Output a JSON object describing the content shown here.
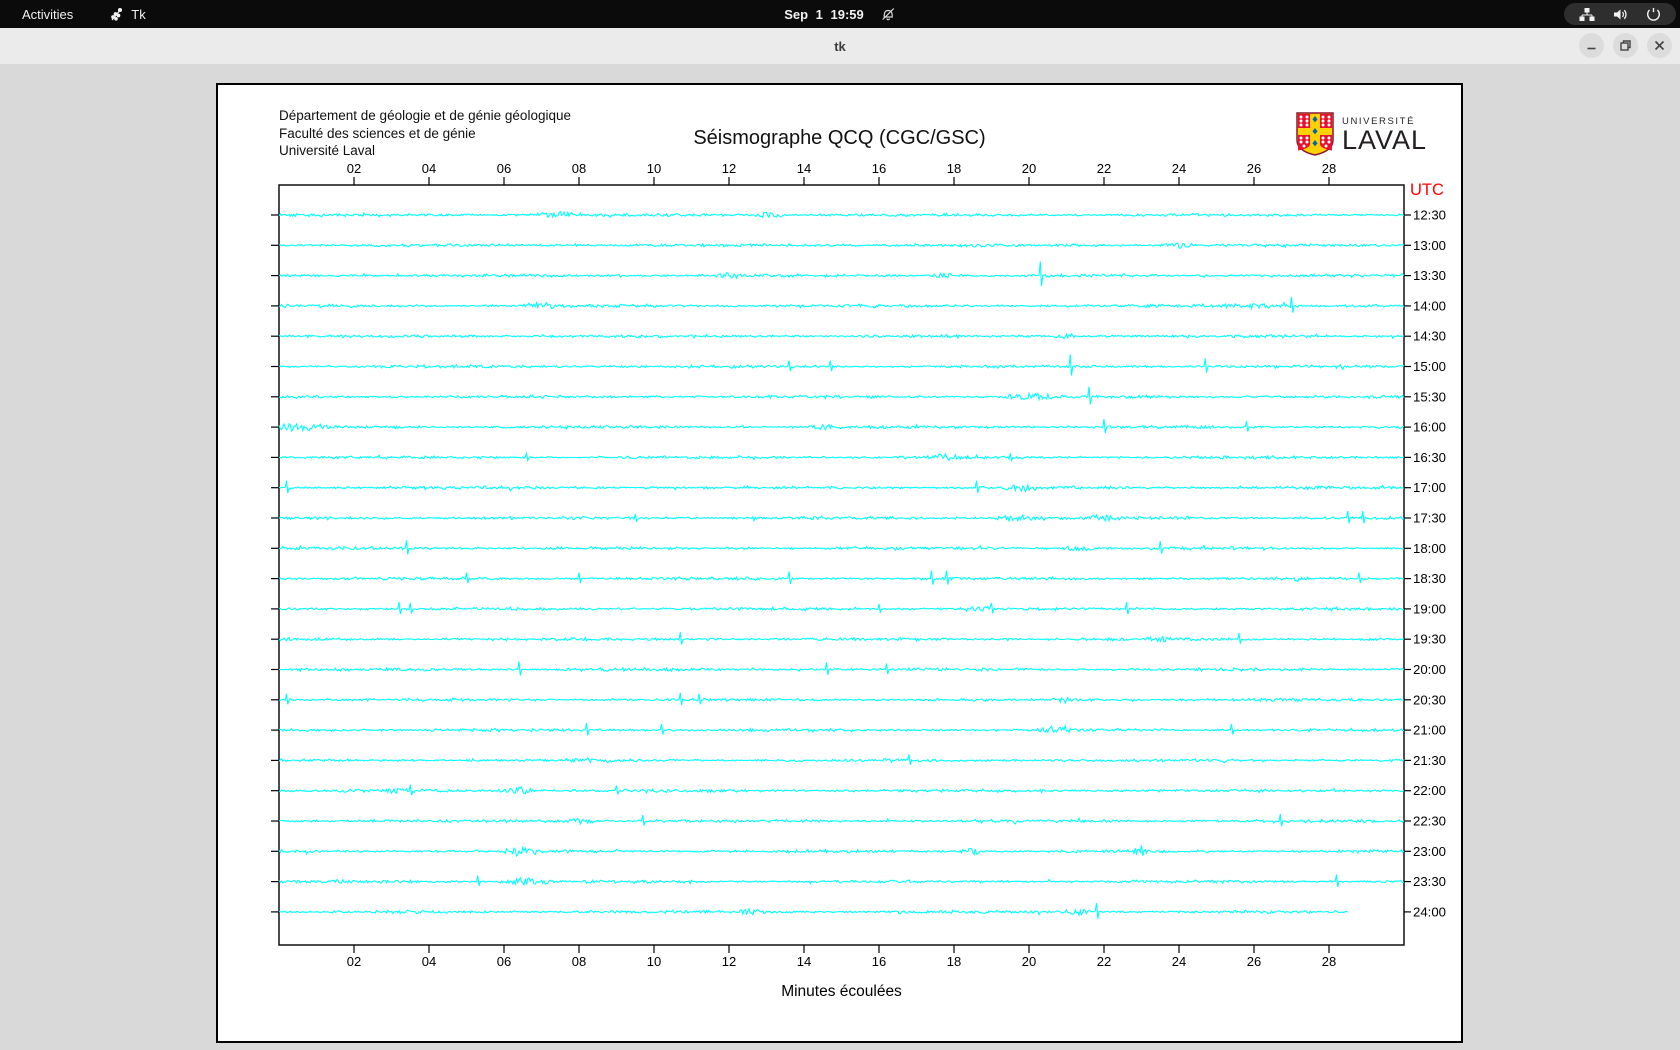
{
  "topbar": {
    "activities_label": "Activities",
    "app_label": "Tk",
    "clock": "Sep 1 19:59"
  },
  "titlebar": {
    "title": "tk"
  },
  "panel": {
    "header_lines": [
      "Département de géologie et de génie géologique",
      "Faculté des sciences et de génie",
      "Université Laval"
    ],
    "logo": {
      "line1": "UNIVERSITÉ",
      "line2": "LAVAL"
    }
  },
  "colors": {
    "trace": "#00ffff",
    "utc_label": "#ff0000",
    "panel_bg": "#ffffff",
    "window_bg": "#d9d9d9",
    "topbar_bg": "#0b0b0b",
    "frame": "#000000"
  },
  "chart_data": {
    "type": "line",
    "title": "Séismographe QCQ (CGC/GSC)",
    "xlabel": "Minutes écoulées",
    "right_axis_title": "UTC",
    "x_ticks": [
      "02",
      "04",
      "06",
      "08",
      "10",
      "12",
      "14",
      "16",
      "18",
      "20",
      "22",
      "24",
      "26",
      "28"
    ],
    "x_range_minutes": [
      0,
      30
    ],
    "grid": false,
    "legend": "none",
    "trace_color": "#00ffff",
    "traces": [
      {
        "utc": "12:30",
        "spikes": [],
        "bursts": [
          [
            7.4,
            0.8,
            3
          ],
          [
            13.0,
            0.5,
            3
          ]
        ]
      },
      {
        "utc": "13:00",
        "spikes": [],
        "bursts": [
          [
            24.0,
            0.5,
            3
          ]
        ]
      },
      {
        "utc": "13:30",
        "spikes": [
          [
            20.3,
            14
          ]
        ],
        "bursts": [
          [
            12.0,
            0.4,
            3
          ],
          [
            17.7,
            0.4,
            3
          ]
        ]
      },
      {
        "utc": "14:00",
        "spikes": [
          [
            27.0,
            9
          ]
        ],
        "bursts": [
          [
            7.1,
            0.6,
            3.5
          ],
          [
            26.0,
            1.5,
            2.5
          ]
        ]
      },
      {
        "utc": "14:30",
        "spikes": [],
        "bursts": [
          [
            21.0,
            0.3,
            3
          ]
        ]
      },
      {
        "utc": "15:00",
        "spikes": [
          [
            13.6,
            6
          ],
          [
            14.7,
            6
          ],
          [
            21.1,
            12
          ],
          [
            24.7,
            8
          ]
        ],
        "bursts": []
      },
      {
        "utc": "15:30",
        "spikes": [
          [
            21.6,
            10
          ]
        ],
        "bursts": [
          [
            19.9,
            0.8,
            3.5
          ]
        ]
      },
      {
        "utc": "16:00",
        "spikes": [
          [
            22.0,
            8
          ],
          [
            25.8,
            6
          ]
        ],
        "bursts": [
          [
            0.5,
            0.9,
            4
          ],
          [
            14.5,
            0.4,
            3
          ]
        ]
      },
      {
        "utc": "16:30",
        "spikes": [
          [
            6.6,
            4
          ],
          [
            19.5,
            4
          ]
        ],
        "bursts": [
          [
            17.8,
            0.5,
            3
          ]
        ]
      },
      {
        "utc": "17:00",
        "spikes": [
          [
            0.2,
            7
          ],
          [
            18.6,
            7
          ]
        ],
        "bursts": [
          [
            19.8,
            0.6,
            3.5
          ]
        ]
      },
      {
        "utc": "17:30",
        "spikes": [
          [
            9.5,
            4
          ],
          [
            28.5,
            7
          ],
          [
            28.9,
            7
          ]
        ],
        "bursts": [
          [
            19.7,
            0.7,
            3.5
          ],
          [
            22.0,
            0.5,
            3
          ]
        ]
      },
      {
        "utc": "18:00",
        "spikes": [
          [
            3.4,
            8
          ],
          [
            23.5,
            7
          ]
        ],
        "bursts": [
          [
            21.3,
            0.5,
            3
          ]
        ]
      },
      {
        "utc": "18:30",
        "spikes": [
          [
            5.0,
            6
          ],
          [
            8.0,
            6
          ],
          [
            13.6,
            7
          ],
          [
            17.4,
            8
          ],
          [
            17.8,
            8
          ],
          [
            28.8,
            6
          ]
        ],
        "bursts": []
      },
      {
        "utc": "19:00",
        "spikes": [
          [
            3.2,
            7
          ],
          [
            3.5,
            6
          ],
          [
            16.0,
            5
          ],
          [
            19.0,
            6
          ],
          [
            22.6,
            7
          ]
        ],
        "bursts": [
          [
            18.6,
            0.6,
            3
          ]
        ]
      },
      {
        "utc": "19:30",
        "spikes": [
          [
            10.7,
            7
          ],
          [
            25.6,
            6
          ]
        ],
        "bursts": [
          [
            23.5,
            0.4,
            3
          ]
        ]
      },
      {
        "utc": "20:00",
        "spikes": [
          [
            6.4,
            8
          ],
          [
            14.6,
            7
          ],
          [
            16.2,
            6
          ]
        ],
        "bursts": []
      },
      {
        "utc": "20:30",
        "spikes": [
          [
            0.2,
            6
          ],
          [
            10.7,
            7
          ],
          [
            11.2,
            6
          ]
        ],
        "bursts": [
          [
            20.9,
            0.5,
            3
          ]
        ]
      },
      {
        "utc": "21:00",
        "spikes": [
          [
            8.2,
            7
          ],
          [
            10.2,
            6
          ],
          [
            25.4,
            6
          ]
        ],
        "bursts": [
          [
            20.8,
            0.6,
            3.5
          ]
        ]
      },
      {
        "utc": "21:30",
        "spikes": [
          [
            16.8,
            6
          ]
        ],
        "bursts": [
          [
            8.0,
            0.4,
            3
          ]
        ]
      },
      {
        "utc": "22:00",
        "spikes": [
          [
            3.5,
            6
          ],
          [
            9.0,
            5
          ]
        ],
        "bursts": [
          [
            3.2,
            0.4,
            3
          ],
          [
            6.3,
            0.6,
            4
          ]
        ]
      },
      {
        "utc": "22:30",
        "spikes": [
          [
            9.7,
            6
          ],
          [
            26.7,
            7
          ]
        ],
        "bursts": [
          [
            8.0,
            0.5,
            3
          ]
        ]
      },
      {
        "utc": "23:00",
        "spikes": [
          [
            23.0,
            6
          ]
        ],
        "bursts": [
          [
            6.4,
            0.6,
            3.5
          ],
          [
            18.5,
            0.4,
            3
          ],
          [
            22.9,
            0.4,
            3
          ]
        ]
      },
      {
        "utc": "23:30",
        "spikes": [
          [
            5.3,
            6
          ],
          [
            28.2,
            7
          ]
        ],
        "bursts": [
          [
            6.6,
            0.7,
            4
          ]
        ]
      },
      {
        "utc": "24:00",
        "spikes": [
          [
            21.8,
            9
          ]
        ],
        "bursts": [
          [
            12.7,
            0.5,
            3
          ],
          [
            21.3,
            0.5,
            3
          ]
        ],
        "end_minute": 28.5
      }
    ]
  }
}
